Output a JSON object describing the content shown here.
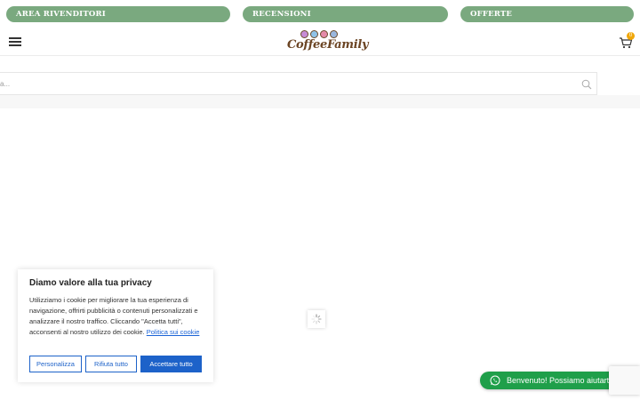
{
  "topbar": {
    "links": [
      "AREA RIVENDITORI",
      "RECENSIONI",
      "OFFERTE"
    ]
  },
  "header": {
    "logo_text": "CoffeeFamily",
    "cart_count": "0",
    "logo_dot_colors": [
      "#c78bd6",
      "#8fc3e8",
      "#e48aa8",
      "#9ab7dd"
    ]
  },
  "search": {
    "placeholder": "a..."
  },
  "cookie": {
    "title": "Diamo valore alla tua privacy",
    "text": "Utilizziamo i cookie per migliorare la tua esperienza di navigazione, offrirti pubblicità o contenuti personalizzati e analizzare il nostro traffico. Cliccando \"Accetta tutti\", acconsenti al nostro utilizzo dei cookie.",
    "policy_link": "Politica sui cookie",
    "btn_customize": "Personalizza",
    "btn_reject": "Rifiuta tutto",
    "btn_accept": "Accettare tutto"
  },
  "whatsapp": {
    "label": "Benvenuto! Possiamo aiutarti?"
  },
  "colors": {
    "pill_green": "#7aa97f",
    "brand_brown": "#6b4423",
    "cookie_blue": "#1d62c9",
    "whatsapp_green": "#1f9f4a",
    "badge_orange": "#f0a70a"
  }
}
